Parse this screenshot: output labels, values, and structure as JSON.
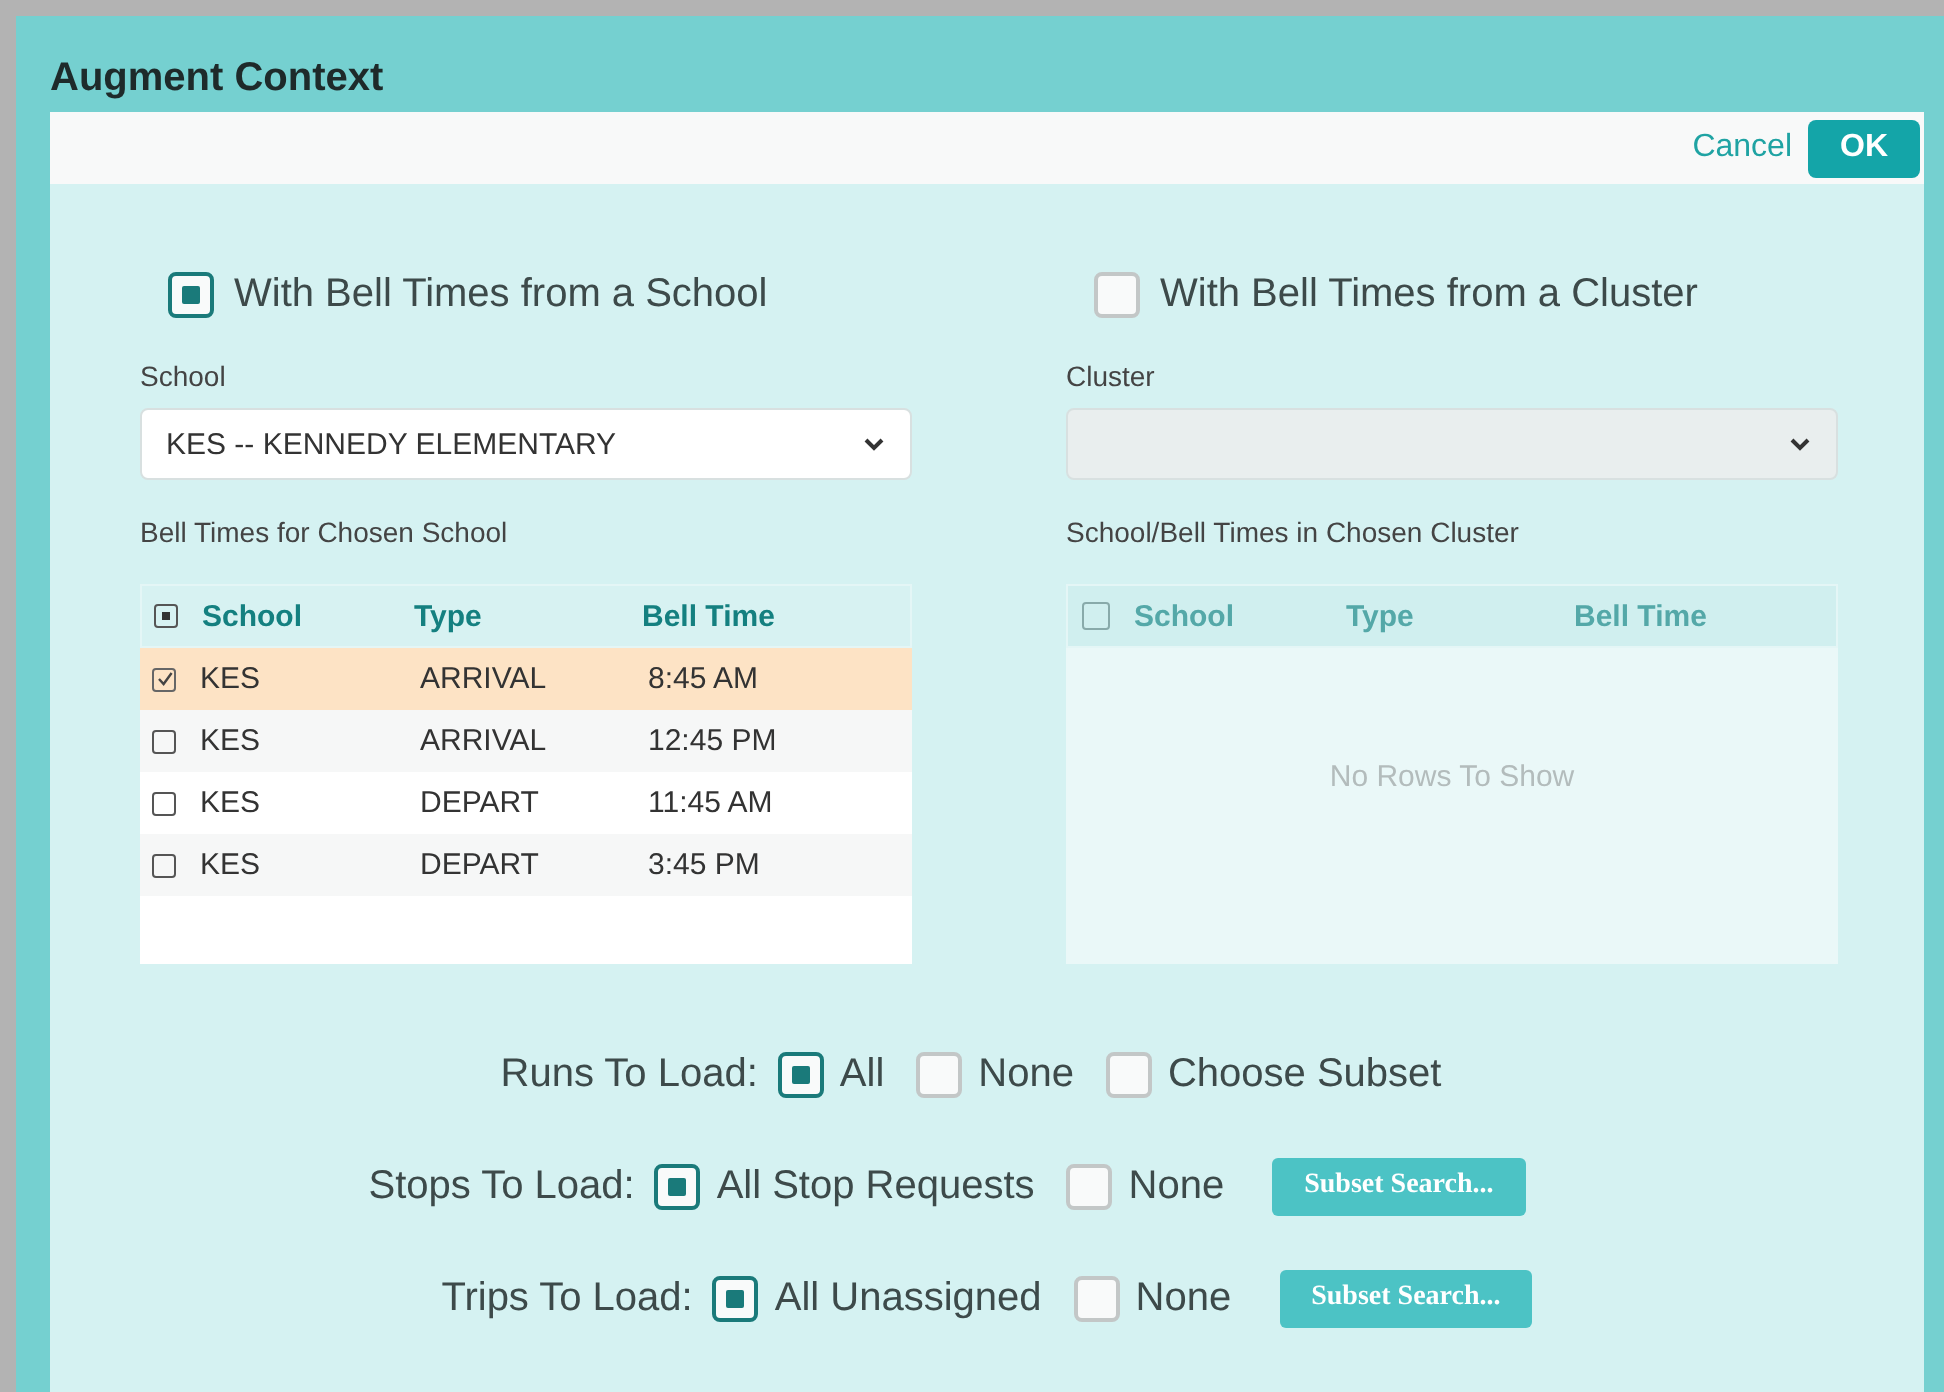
{
  "window": {
    "title": "Augment Context"
  },
  "toolbar": {
    "cancel": "Cancel",
    "ok": "OK"
  },
  "source_options": [
    {
      "label": "With Bell Times from a School",
      "selected": true
    },
    {
      "label": "With Bell Times from a Cluster",
      "selected": false
    }
  ],
  "panels": [
    {
      "field_label": "School",
      "value": "KES -- KENNEDY ELEMENTARY",
      "disabled": false,
      "grid_label": "Bell Times for Chosen School",
      "header_partial": true,
      "columns": [
        "School",
        "Type",
        "Bell Time"
      ],
      "rows": [
        {
          "cells": [
            "KES",
            "ARRIVAL",
            "8:45 AM"
          ],
          "selected": true
        },
        {
          "cells": [
            "KES",
            "ARRIVAL",
            "12:45 PM"
          ],
          "selected": false
        },
        {
          "cells": [
            "KES",
            "DEPART",
            "11:45 AM"
          ],
          "selected": false
        },
        {
          "cells": [
            "KES",
            "DEPART",
            "3:45 PM"
          ],
          "selected": false
        }
      ]
    },
    {
      "field_label": "Cluster",
      "disabled": true,
      "grid_label": "School/Bell Times in Chosen Cluster",
      "header_partial": false,
      "columns": [
        "School",
        "Type",
        "Bell Time"
      ],
      "empty_text": "No Rows To Show"
    }
  ],
  "load_options": [
    {
      "label": "Runs To Load:",
      "choices": [
        {
          "label": "All",
          "selected": true
        },
        {
          "label": "None",
          "selected": false
        },
        {
          "label": "Choose Subset",
          "selected": false
        }
      ]
    },
    {
      "label": "Stops To Load:",
      "choices": [
        {
          "label": "All Stop Requests",
          "selected": true
        },
        {
          "label": "None",
          "selected": false
        }
      ],
      "button": "Subset Search..."
    },
    {
      "label": "Trips To Load:",
      "choices": [
        {
          "label": "All Unassigned",
          "selected": true
        },
        {
          "label": "None",
          "selected": false
        }
      ],
      "button": "Subset Search..."
    }
  ]
}
